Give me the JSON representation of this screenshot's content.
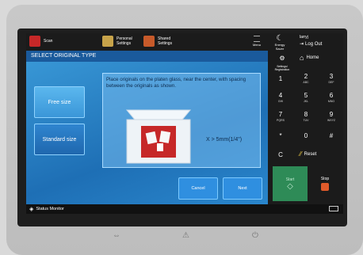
{
  "topbar": {
    "scan_label": "Scan",
    "personal_label": "Personal\nSettings",
    "shared_label": "Shared\nSettings",
    "menu_label": "Menu",
    "energy_label": "Energy Saver",
    "user_label": "larryj",
    "logout_label": "Log Out"
  },
  "main": {
    "title": "SELECT ORIGINAL TYPE",
    "free_size_label": "Free size",
    "standard_size_label": "Standard size",
    "instruction": "Place originals on the platen glass, near the center, with spacing between the originals as shown.",
    "spacing_label": "X > 5mm(1/4\")",
    "cancel_label": "Cancel",
    "next_label": "Next"
  },
  "right": {
    "settings_label": "Settings/\nRegistration",
    "home_label": "Home",
    "keys": [
      {
        "main": "1",
        "sub": ""
      },
      {
        "main": "2",
        "sub": "ABC"
      },
      {
        "main": "3",
        "sub": "DEF"
      },
      {
        "main": "4",
        "sub": "GHI"
      },
      {
        "main": "5",
        "sub": "JKL"
      },
      {
        "main": "6",
        "sub": "MNO"
      },
      {
        "main": "7",
        "sub": "PQRS"
      },
      {
        "main": "8",
        "sub": "TUV"
      },
      {
        "main": "9",
        "sub": "WXYZ"
      },
      {
        "main": "*",
        "sub": ""
      },
      {
        "main": "0",
        "sub": ""
      },
      {
        "main": "#",
        "sub": ""
      }
    ],
    "clear_label": "C",
    "reset_label": "Reset",
    "start_label": "Start",
    "stop_label": "Stop"
  },
  "status": {
    "monitor_label": "Status Monitor"
  },
  "colors": {
    "accent_blue": "#1e6fb5",
    "start_green": "#2e8b57",
    "stop_orange": "#e05a2a"
  }
}
